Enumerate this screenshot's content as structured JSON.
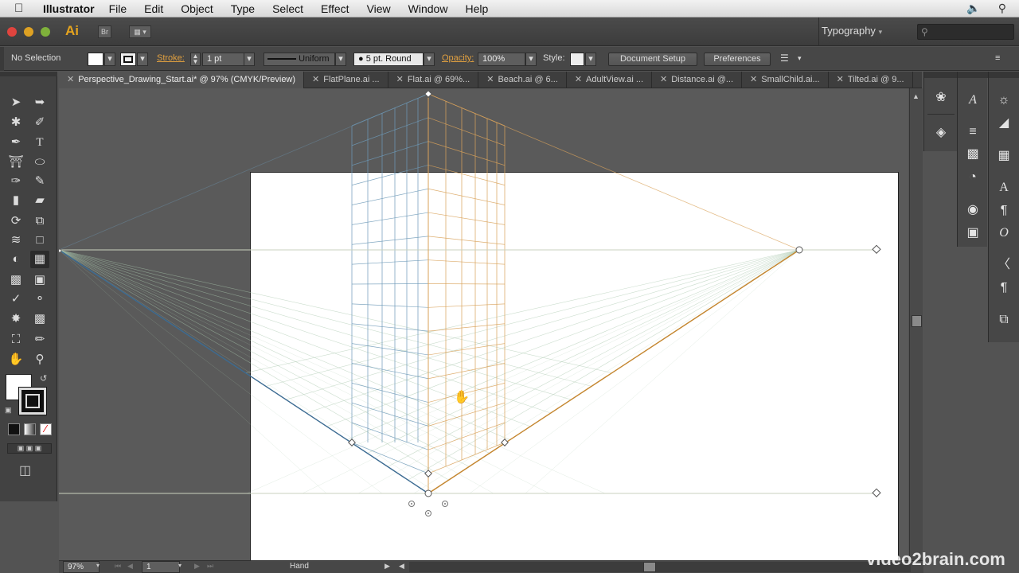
{
  "menubar": {
    "app_name": "Illustrator",
    "items": [
      "File",
      "Edit",
      "Object",
      "Type",
      "Select",
      "Effect",
      "View",
      "Window",
      "Help"
    ]
  },
  "appbar": {
    "logo": "Ai",
    "bridge": "Br",
    "workspace": "Typography",
    "search_placeholder": ""
  },
  "control": {
    "selection": "No Selection",
    "stroke_label": "Stroke:",
    "stroke_weight": "1 pt",
    "profile": "Uniform",
    "brush": "5 pt. Round",
    "opacity_label": "Opacity:",
    "opacity": "100%",
    "style_label": "Style:",
    "doc_setup": "Document Setup",
    "preferences": "Preferences"
  },
  "tabs": [
    "Perspective_Drawing_Start.ai* @ 97% (CMYK/Preview)",
    "FlatPlane.ai ...",
    "Flat.ai @ 69%...",
    "Beach.ai @ 6...",
    "AdultView.ai ...",
    "Distance.ai @...",
    "SmallChild.ai...",
    "Tilted.ai @ 9..."
  ],
  "status": {
    "zoom": "97%",
    "artboard": "1",
    "tool": "Hand"
  },
  "watermark": "video2brain.com",
  "colors": {
    "grid_left": "#6e9ab8",
    "grid_right": "#d9a25a",
    "horizon": "#c9d1bf",
    "ground": "#a9c7ad"
  }
}
